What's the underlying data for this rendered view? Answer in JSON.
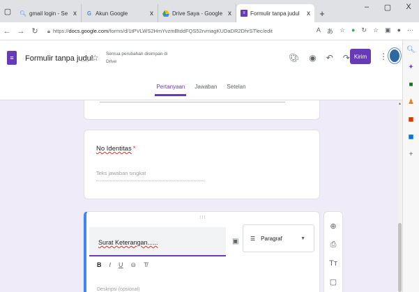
{
  "browser": {
    "tabs": [
      {
        "title": "gmail login - Search",
        "icon": "search-icon"
      },
      {
        "title": "Akun Google",
        "icon": "google-icon"
      },
      {
        "title": "Drive Saya - Google Drive",
        "icon": "drive-icon"
      },
      {
        "title": "Formulir tanpa judul - Google F...",
        "icon": "forms-icon",
        "active": true
      }
    ],
    "url_prefix": "https://",
    "url_domain": "docs.google.com",
    "url_path": "/forms/d/1tPVLWS2HmYvzmBtddFQS52rvmagKUDaDR2DhrSTlec/edit",
    "window_controls": [
      "–",
      "▢",
      "X"
    ]
  },
  "forms": {
    "title": "Formulir tanpa judul",
    "saved_status": "Semua perubahan disimpan di Drive",
    "send_label": "Kirim",
    "tabs": [
      "Pertanyaan",
      "Jawaban",
      "Setelan"
    ],
    "active_tab": "Pertanyaan"
  },
  "questions": [
    {
      "title": "No Identitas",
      "required": true,
      "hint": "Teks jawaban singkat"
    }
  ],
  "editing_question": {
    "title": "Surat Keterangan......",
    "type_label": "Paragraf",
    "description_hint": "Deskripsi (opsional)"
  },
  "colors": {
    "accent": "#673ab7",
    "focus_border": "#4285f4",
    "background": "#f0ebf8",
    "required": "#d93025"
  }
}
